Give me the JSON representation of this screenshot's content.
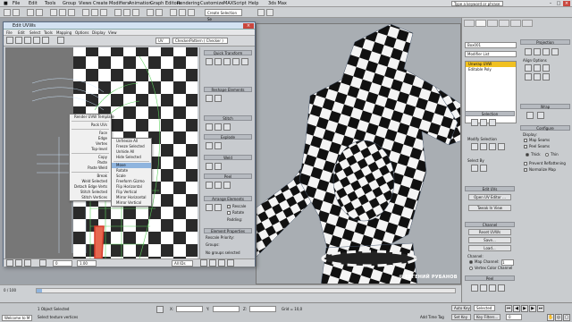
{
  "menubar": {
    "items": [
      "File",
      "Edit",
      "Tools",
      "Group",
      "Views",
      "Create",
      "Modifiers",
      "Animation",
      "Graph Editors",
      "Rendering",
      "Customize",
      "MAXScript",
      "Help"
    ],
    "title": "3ds Max",
    "search_placeholder": "Type a keyword or phrase"
  },
  "toolbar": {
    "selection_set": "Create Selection Se"
  },
  "uvw": {
    "title": "Edit UVWs",
    "menu": [
      "File",
      "Edit",
      "Select",
      "Tools",
      "Mapping",
      "Options",
      "Display",
      "View"
    ],
    "uvw_mode": "UV",
    "checker_name": "CheckerPattern ( Checker )",
    "canvas_zoom": "All IDs",
    "side": {
      "quick_transform": "Quick Transform",
      "reshape": "Reshape Elements",
      "stitch": "Stitch",
      "explode": "Explode",
      "weld": "Weld",
      "peel": "Peel",
      "arrange": "Arrange Elements",
      "rescale": "Rescale",
      "rotate": "Rotate",
      "padding": "Padding:",
      "element_props": "Element Properties",
      "rescale_priority": "Rescale Priority:",
      "groups": "Groups:",
      "no_groups": "No groups selected"
    },
    "bottom": {
      "coord_u": "0",
      "coord_v": "1.00",
      "all_ids": "All IDs"
    }
  },
  "context_menu_left": {
    "items": [
      "Render UVW Template",
      "Pack UVs",
      "Face",
      "Edge",
      "Vertex",
      "Top-level",
      "Copy",
      "Paste",
      "Paste Weld",
      "Break",
      "Weld Selected",
      "Detach Edge Verts",
      "Stitch Selected",
      "Stitch Vertices"
    ]
  },
  "context_menu_mid": {
    "items": [
      "Unfreeze All",
      "Freeze Selected",
      "Unhide All",
      "Hide Selected",
      "Move",
      "Rotate",
      "Scale",
      "Freeform Gizmo",
      "Flip Horizontal",
      "Flip Vertical",
      "Mirror Horizontal",
      "Mirror Vertical"
    ]
  },
  "command_panel": {
    "object_name": "Box001",
    "modifier_list": "Modifier List",
    "stack": [
      "Unwrap UVW",
      "Editable Poly"
    ],
    "rollouts": {
      "selection": "Selection",
      "modify_selection": "Modify Selection",
      "select_by": "Select By",
      "edit_uvs": "Edit UVs",
      "open_uv_editor": "Open UV Editor ...",
      "tweak_in_view": "Tweak In View",
      "channel": "Channel",
      "reset_uvws": "Reset UVWs",
      "save": "Save...",
      "load": "Load...",
      "channel_label": "Channel:",
      "map_channel": "Map Channel:",
      "map_channel_value": "1",
      "vertex_color": "Vertex Color Channel",
      "peel": "Peel",
      "projection": "Projection",
      "align_options": "Align Options",
      "wrap": "Wrap",
      "configure": "Configure",
      "display": "Display:",
      "map_seams": "Map Seams",
      "peel_seams": "Peel Seams",
      "thick": "Thick",
      "thin": "Thin",
      "prevent_reflattening": "Prevent Reflattening",
      "normalize_map": "Normalize Map"
    }
  },
  "watermark": "© ЕВГЕНИЙ РУБАНОВ",
  "status": {
    "selected": "1 Object Selected",
    "prompt": "Select texture vertices",
    "welcome": "Welcome to M",
    "x": "X:",
    "y": "Y:",
    "z": "Z:",
    "grid": "Grid = 10,0",
    "add_time_tag": "Add Time Tag",
    "auto_key": "Auto Key",
    "set_key": "Set Key",
    "selected_dd": "Selected",
    "key_filters": "Key Filters...",
    "frame": "0"
  },
  "timeline": {
    "counter": "0 / 100"
  },
  "colors": {
    "accent_yellow": "#f0c020",
    "title_blue": "#d3e2f2",
    "uv_seam_green": "#5ed05e",
    "highlight": "#8fb4de"
  }
}
